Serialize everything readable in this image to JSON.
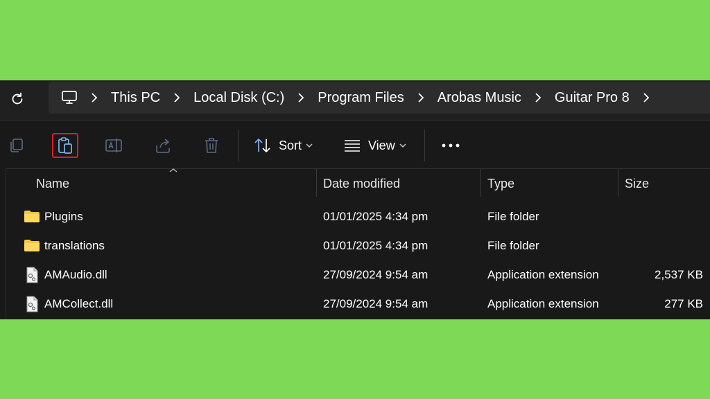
{
  "address_bar": {
    "breadcrumbs": [
      "This PC",
      "Local Disk (C:)",
      "Program Files",
      "Arobas Music",
      "Guitar Pro 8"
    ]
  },
  "toolbar": {
    "sort_label": "Sort",
    "view_label": "View",
    "highlight_color": "#e01e27",
    "icons": [
      "copy-icon",
      "paste-icon",
      "rename-icon",
      "share-icon",
      "delete-icon",
      "sort-icon",
      "view-icon",
      "more-icon"
    ]
  },
  "columns": {
    "name": "Name",
    "date": "Date modified",
    "type": "Type",
    "size": "Size"
  },
  "files": [
    {
      "name": "Plugins",
      "date": "01/01/2025 4:34 pm",
      "type": "File folder",
      "size": "",
      "icon": "folder-icon"
    },
    {
      "name": "translations",
      "date": "01/01/2025 4:34 pm",
      "type": "File folder",
      "size": "",
      "icon": "folder-icon"
    },
    {
      "name": "AMAudio.dll",
      "date": "27/09/2024 9:54 am",
      "type": "Application extension",
      "size": "2,537 KB",
      "icon": "dll-file-icon"
    },
    {
      "name": "AMCollect.dll",
      "date": "27/09/2024 9:54 am",
      "type": "Application extension",
      "size": "277 KB",
      "icon": "dll-file-icon"
    }
  ],
  "colors": {
    "background": "#7ed957",
    "folder": "#f5c541",
    "window": "#191919"
  }
}
